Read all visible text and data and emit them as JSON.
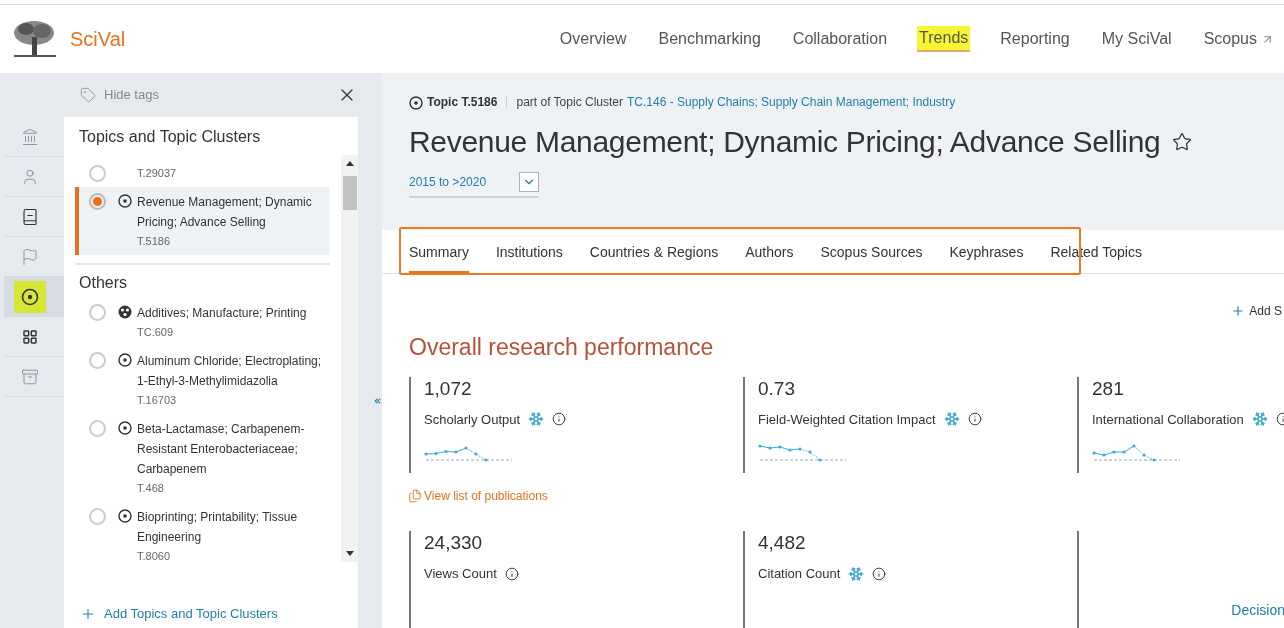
{
  "header": {
    "logo_text": "SciVal",
    "nav": [
      {
        "label": "Overview",
        "selected": false,
        "external": false
      },
      {
        "label": "Benchmarking",
        "selected": false,
        "external": false
      },
      {
        "label": "Collaboration",
        "selected": false,
        "external": false
      },
      {
        "label": "Trends",
        "selected": true,
        "external": false
      },
      {
        "label": "Reporting",
        "selected": false,
        "external": false
      },
      {
        "label": "My SciVal",
        "selected": false,
        "external": false
      },
      {
        "label": "Scopus",
        "selected": false,
        "external": true
      }
    ]
  },
  "icon_rail": [
    {
      "kind": "institution",
      "selected": false
    },
    {
      "kind": "person",
      "selected": false
    },
    {
      "kind": "document",
      "selected": false
    },
    {
      "kind": "flag",
      "selected": false
    },
    {
      "kind": "topic",
      "selected": true
    },
    {
      "kind": "grid",
      "selected": false
    },
    {
      "kind": "archive",
      "selected": false
    }
  ],
  "tags_panel": {
    "hide_tags": "Hide tags",
    "section_title": "Topics and Topic Clusters",
    "current": [
      {
        "code": "T.29037",
        "selected": false
      },
      {
        "kind": "topic",
        "name": "Revenue Management; Dynamic Pricing; Advance Selling",
        "code": "T.5186",
        "selected": true
      }
    ],
    "others_title": "Others",
    "others": [
      {
        "kind": "cluster",
        "name": "Additives; Manufacture; Printing",
        "code": "TC.609",
        "selected": false
      },
      {
        "kind": "topic",
        "name": "Aluminum Chloride; Electroplating; 1-Ethyl-3-Methylimidazolia",
        "code": "T.16703",
        "selected": false
      },
      {
        "kind": "topic",
        "name": "Beta-Lactamase; Carbapenem-Resistant Enterobacteriaceae; Carbapenem",
        "code": "T.468",
        "selected": false
      },
      {
        "kind": "topic",
        "name": "Bioprinting; Printability; Tissue Engineering",
        "code": "T.8060",
        "selected": false
      }
    ],
    "add_link": "Add Topics and Topic Clusters"
  },
  "main": {
    "breadcrumb": {
      "topic_label": "Topic T.5186",
      "part_of": "part of Topic Cluster",
      "cluster_link": "TC.146 - Supply Chains; Supply Chain Management; Industry"
    },
    "title": "Revenue Management; Dynamic Pricing; Advance Selling",
    "favorite": false,
    "date_range": "2015 to >2020",
    "tabs": [
      {
        "label": "Summary",
        "selected": true
      },
      {
        "label": "Institutions",
        "selected": false
      },
      {
        "label": "Countries & Regions",
        "selected": false
      },
      {
        "label": "Authors",
        "selected": false
      },
      {
        "label": "Scopus Sources",
        "selected": false
      },
      {
        "label": "Keyphrases",
        "selected": false
      },
      {
        "label": "Related Topics",
        "selected": false
      }
    ],
    "add_link": "Add S",
    "section_title": "Overall research performance",
    "metrics": [
      {
        "value": "1,072",
        "label": "Scholarly Output",
        "snowball": true,
        "sparkline": true
      },
      {
        "value": "0.73",
        "label": "Field-Weighted Citation Impact",
        "snowball": true,
        "sparkline": true
      },
      {
        "value": "281",
        "label": "International Collaboration",
        "snowball": true,
        "sparkline": true
      }
    ],
    "view_list": "View list of publications",
    "metrics_2": [
      {
        "value": "24,330",
        "label": "Views Count",
        "snowball": false,
        "sparkline": false
      },
      {
        "value": "4,482",
        "label": "Citation Count",
        "snowball": true,
        "sparkline": false
      }
    ],
    "decision": "Decision"
  }
}
